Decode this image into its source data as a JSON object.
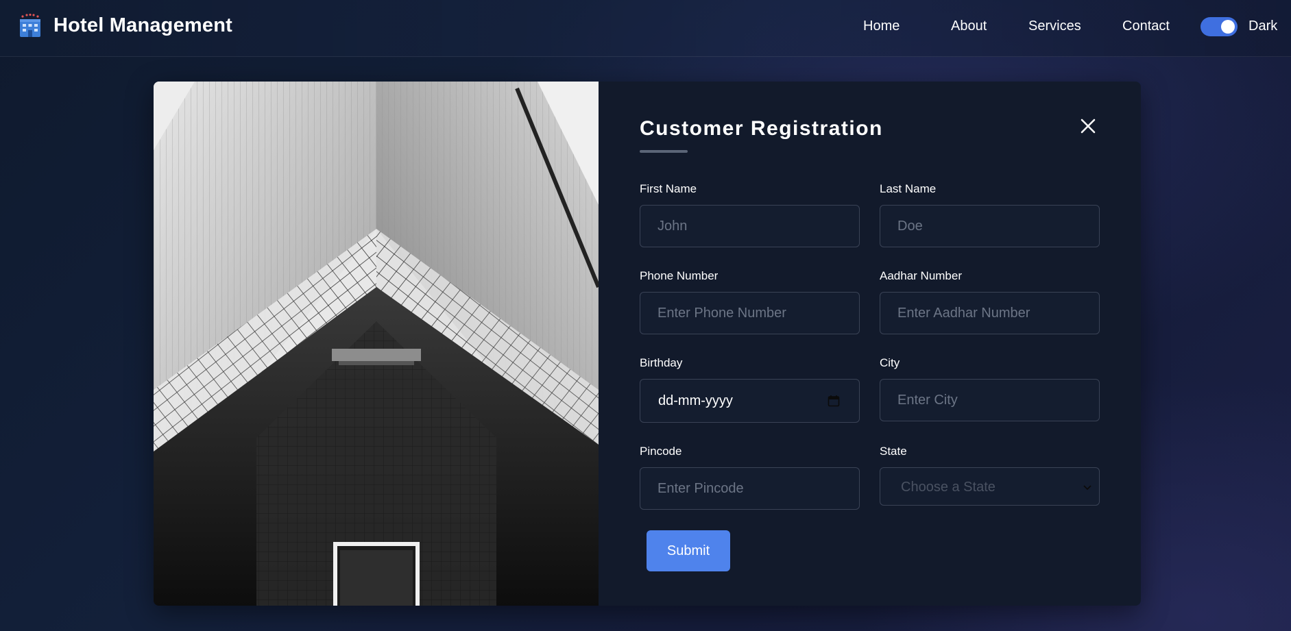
{
  "header": {
    "brand_title": "Hotel Management",
    "brand_icon": "hotel-building-icon",
    "nav": [
      {
        "label": "Home"
      },
      {
        "label": "About"
      },
      {
        "label": "Services"
      },
      {
        "label": "Contact"
      }
    ],
    "theme_toggle": {
      "label": "Dark",
      "on": true
    }
  },
  "form": {
    "title": "Customer Registration",
    "close_icon": "close-icon",
    "fields": {
      "first_name": {
        "label": "First Name",
        "placeholder": "John",
        "value": ""
      },
      "last_name": {
        "label": "Last Name",
        "placeholder": "Doe",
        "value": ""
      },
      "phone": {
        "label": "Phone Number",
        "placeholder": "Enter Phone Number",
        "value": ""
      },
      "aadhar": {
        "label": "Aadhar Number",
        "placeholder": "Enter Aadhar Number",
        "value": ""
      },
      "birthday": {
        "label": "Birthday",
        "display": "dd-mm-yyyy",
        "icon": "calendar-icon"
      },
      "city": {
        "label": "City",
        "placeholder": "Enter City",
        "value": ""
      },
      "pincode": {
        "label": "Pincode",
        "placeholder": "Enter Pincode",
        "value": ""
      },
      "state": {
        "label": "State",
        "selected": "Choose a State",
        "icon": "chevron-down-icon"
      }
    },
    "submit_label": "Submit"
  },
  "colors": {
    "accent": "#4f83ec",
    "toggle": "#3f6fe0",
    "card_bg": "#121a2b",
    "input_border": "#3a4356"
  }
}
